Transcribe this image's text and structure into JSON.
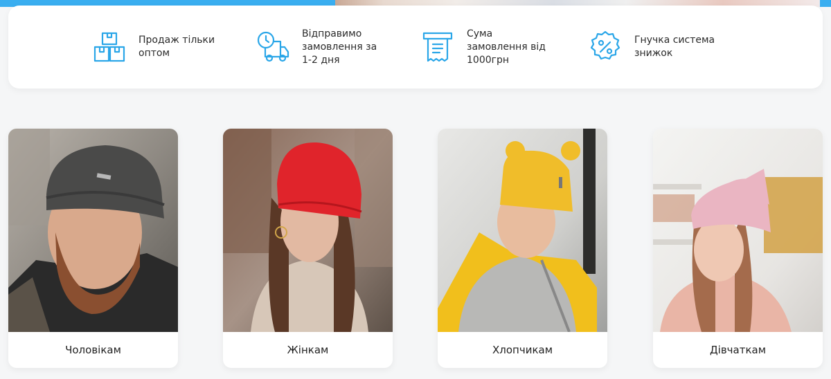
{
  "accent_color": "#2aa6e8",
  "features": [
    {
      "icon": "boxes-icon",
      "text": "Продаж тільки оптом"
    },
    {
      "icon": "delivery-truck-icon",
      "text": "Відправимо замовлення за 1-2 дня"
    },
    {
      "icon": "receipt-icon",
      "text": "Сума замовлення від 1000грн"
    },
    {
      "icon": "discount-badge-icon",
      "text": "Гнучка система знижок"
    }
  ],
  "categories": [
    {
      "label": "Чоловікам",
      "image": "man-in-gray-beanie"
    },
    {
      "label": "Жінкам",
      "image": "woman-in-red-beanie"
    },
    {
      "label": "Хлопчикам",
      "image": "boy-in-yellow-beanie"
    },
    {
      "label": "Дівчаткам",
      "image": "girl-in-pink-beanie"
    }
  ]
}
